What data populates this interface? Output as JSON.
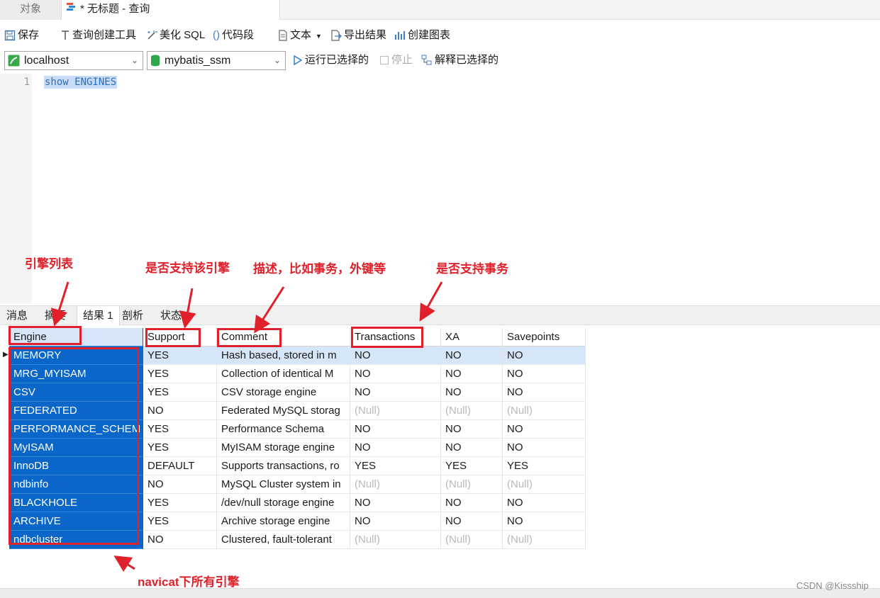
{
  "tabs": {
    "objects": "对象",
    "query": "* 无标题 - 查询"
  },
  "toolbar": {
    "save": "保存",
    "query_builder": "查询创建工具",
    "beautify_sql": "美化 SQL",
    "code_snippet": "代码段",
    "text": "文本",
    "export_result": "导出结果",
    "create_chart": "创建图表"
  },
  "connection": {
    "server": "localhost",
    "database": "mybatis_ssm",
    "run_selected": "运行已选择的",
    "stop": "停止",
    "explain_selected": "解释已选择的"
  },
  "editor": {
    "line_number": "1",
    "code": "show ENGINES"
  },
  "result_tabs": [
    "消息",
    "摘要",
    "结果 1",
    "剖析",
    "状态"
  ],
  "grid": {
    "columns": [
      "Engine",
      "Support",
      "Comment",
      "Transactions",
      "XA",
      "Savepoints"
    ],
    "rows": [
      [
        "MEMORY",
        "YES",
        "Hash based, stored in m",
        "NO",
        "NO",
        "NO"
      ],
      [
        "MRG_MYISAM",
        "YES",
        "Collection of identical M",
        "NO",
        "NO",
        "NO"
      ],
      [
        "CSV",
        "YES",
        "CSV storage engine",
        "NO",
        "NO",
        "NO"
      ],
      [
        "FEDERATED",
        "NO",
        "Federated MySQL storag",
        "(Null)",
        "(Null)",
        "(Null)"
      ],
      [
        "PERFORMANCE_SCHEM",
        "YES",
        "Performance Schema",
        "NO",
        "NO",
        "NO"
      ],
      [
        "MyISAM",
        "YES",
        "MyISAM storage engine",
        "NO",
        "NO",
        "NO"
      ],
      [
        "InnoDB",
        "DEFAULT",
        "Supports transactions, ro",
        "YES",
        "YES",
        "YES"
      ],
      [
        "ndbinfo",
        "NO",
        "MySQL Cluster system in",
        "(Null)",
        "(Null)",
        "(Null)"
      ],
      [
        "BLACKHOLE",
        "YES",
        "/dev/null storage engine",
        "NO",
        "NO",
        "NO"
      ],
      [
        "ARCHIVE",
        "YES",
        "Archive storage engine",
        "NO",
        "NO",
        "NO"
      ],
      [
        "ndbcluster",
        "NO",
        "Clustered, fault-tolerant",
        "(Null)",
        "(Null)",
        "(Null)"
      ]
    ]
  },
  "annotations": {
    "engine_list": "引擎列表",
    "support": "是否支持该引擎",
    "comment": "描述，比如事务，外键等",
    "transactions": "是否支持事务",
    "all_engines": "navicat下所有引擎"
  },
  "colors": {
    "annotation_red": "#e0202a",
    "selection_blue": "#0a66c8"
  },
  "watermark": "CSDN @Kissship"
}
